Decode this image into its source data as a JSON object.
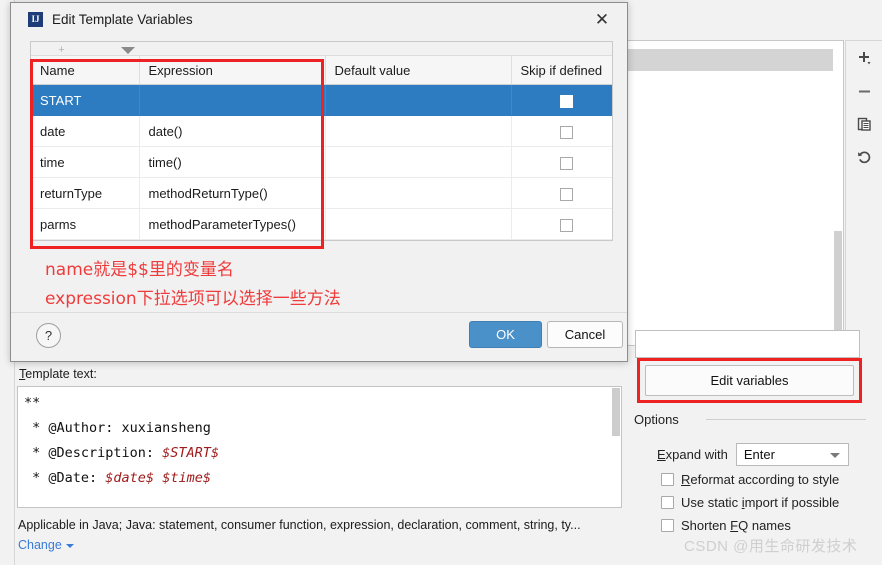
{
  "background": {
    "toolbar_icons": [
      "add-icon",
      "remove-icon",
      "copy-icon",
      "revert-icon"
    ],
    "edit_variables_button": "Edit variables",
    "options_label": "Options",
    "expand_with_label": "Expand with",
    "expand_with_value": "Enter",
    "checkboxes": [
      {
        "label": "Reformat according to style",
        "checked": false
      },
      {
        "label": "Use static import if possible",
        "checked": false
      },
      {
        "label": "Shorten FQ names",
        "checked": false
      }
    ],
    "watermark": "CSDN @用生命研发技术"
  },
  "template_panel": {
    "label": "Template text:",
    "lines": [
      {
        "plain": "**",
        "vars": []
      },
      {
        "plain": " * @Author: xuxiansheng",
        "vars": []
      },
      {
        "plain": " * @Description: ",
        "vars": [
          "$START$"
        ]
      },
      {
        "plain": " * @Date: ",
        "vars": [
          "$date$",
          "$time$"
        ]
      }
    ],
    "line1": "**",
    "line2": " * @Author: xuxiansheng",
    "line3_prefix": " * @Description: ",
    "line3_var": "$START$",
    "line4_prefix": " * @Date: ",
    "line4_var1": "$date$",
    "line4_var2": "$time$",
    "applicable_text": "Applicable in Java; Java: statement, consumer function, expression, declaration, comment, string, ty...",
    "change_link": "Change"
  },
  "dialog": {
    "title": "Edit Template Variables",
    "icon": "intellij-idea-icon",
    "close_icon": "close-icon",
    "help_label": "?",
    "ok_label": "OK",
    "cancel_label": "Cancel",
    "accent_color": "#2d7cc1",
    "table": {
      "columns": [
        "Name",
        "Expression",
        "Default value",
        "Skip if defined"
      ],
      "rows": [
        {
          "name": "START",
          "expression": "",
          "default_value": "",
          "skip_if_defined": false,
          "selected": true
        },
        {
          "name": "date",
          "expression": "date()",
          "default_value": "",
          "skip_if_defined": false,
          "selected": false
        },
        {
          "name": "time",
          "expression": "time()",
          "default_value": "",
          "skip_if_defined": false,
          "selected": false
        },
        {
          "name": "returnType",
          "expression": "methodReturnType()",
          "default_value": "",
          "skip_if_defined": false,
          "selected": false
        },
        {
          "name": "parms",
          "expression": "methodParameterTypes()",
          "default_value": "",
          "skip_if_defined": false,
          "selected": false
        }
      ]
    },
    "annotation": {
      "line1": "name就是$$里的变量名",
      "line2": "expression下拉选项可以选择一些方法",
      "color": "#ef3b3b"
    }
  }
}
